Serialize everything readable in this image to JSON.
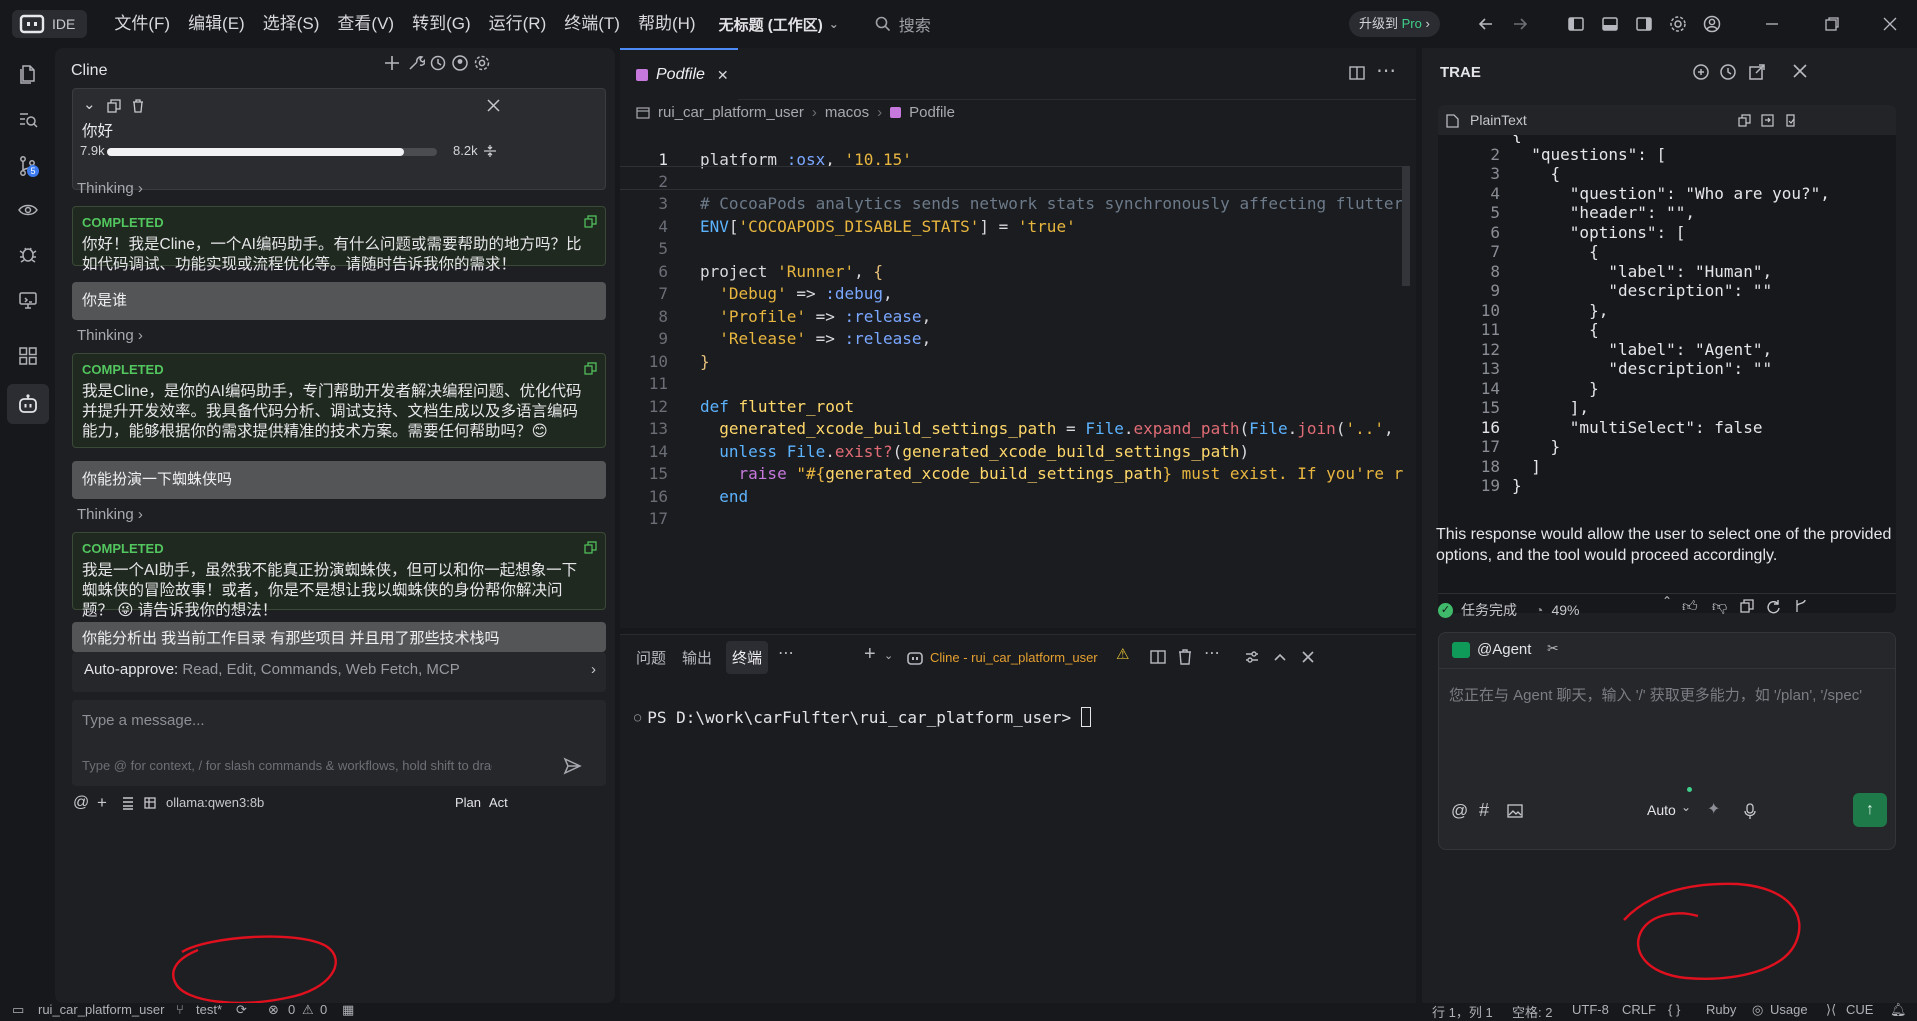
{
  "titlebar": {
    "ide_label": "IDE",
    "menus": [
      "文件(F)",
      "编辑(E)",
      "选择(S)",
      "查看(V)",
      "转到(G)",
      "运行(R)",
      "终端(T)",
      "帮助(H)"
    ],
    "workspace": "无标题 (工作区)",
    "search": "搜索",
    "upgrade_prefix": "升级到",
    "upgrade_pro": "Pro"
  },
  "cline": {
    "title": "Cline",
    "task": {
      "text": "你好",
      "tokens_in": "7.9k",
      "tokens_out": "8.2k",
      "progress": 0.9
    },
    "thinking": "Thinking",
    "messages": [
      {
        "type": "completed",
        "label": "COMPLETED",
        "text": "你好！我是Cline，一个AI编码助手。有什么问题或需要帮助的地方吗？比如代码调试、功能实现或流程优化等。请随时告诉我你的需求！"
      },
      {
        "type": "user",
        "text": "你是谁"
      },
      {
        "type": "completed",
        "label": "COMPLETED",
        "text": "我是Cline，是你的AI编码助手，专门帮助开发者解决编程问题、优化代码并提升开发效率。我具备代码分析、调试支持、文档生成以及多语言编码能力，能够根据你的需求提供精准的技术方案。需要任何帮助吗？😊"
      },
      {
        "type": "user",
        "text": "你能扮演一下蜘蛛侠吗"
      },
      {
        "type": "completed",
        "label": "COMPLETED",
        "text": "我是一个AI助手，虽然我不能真正扮演蜘蛛侠，但可以和你一起想象一下蜘蛛侠的冒险故事！或者，你是不是想让我以蜘蛛侠的身份帮你解决问题？ 😜 请告诉我你的想法！"
      },
      {
        "type": "user",
        "text": "你能分析出 我当前工作目录 有那些项目 并且用了那些技术栈吗"
      }
    ],
    "auto_approve_label": "Auto-approve:",
    "auto_approve_value": "Read, Edit, Commands, Web Fetch, MCP",
    "input_placeholder": "Type a message...",
    "input_hint": "Type @ for context, / for slash commands & workflows, hold shift to drag in...",
    "model": "ollama:qwen3:8b",
    "plan": "Plan",
    "act": "Act"
  },
  "editor": {
    "tab": "Podfile",
    "breadcrumb": [
      "rui_car_platform_user",
      "macos",
      "Podfile"
    ],
    "current_line": 1
  },
  "terminal": {
    "tabs": [
      "问题",
      "输出",
      "终端"
    ],
    "session": "Cline - rui_car_platform_user",
    "prompt": "PS D:\\work\\carFulfter\\rui_car_platform_user> "
  },
  "trae": {
    "title": "TRAE",
    "code_lang": "PlainText",
    "current_line": 16,
    "response": "This response would allow the user to select one of the provided options, and the tool would proceed accordingly.",
    "task_done": "任务完成",
    "percent": "49%",
    "agent": "@Agent",
    "input_placeholder": "您正在与 Agent 聊天，输入 '/' 获取更多能力，如 '/plan', '/spec'",
    "mode": "Auto"
  },
  "status": {
    "branch_folder": "rui_car_platform_user",
    "git": "test*",
    "errors": "0",
    "warnings": "0",
    "position": "行 1，列 1",
    "spaces": "空格: 2",
    "encoding": "UTF-8",
    "eol": "CRLF",
    "braces": "{ }",
    "language": "Ruby",
    "usage": "Usage",
    "cue": "CUE"
  },
  "colors": {
    "accent": "#4c8bf5",
    "completed": "#52c65f",
    "annotation": "#e0101e",
    "send": "#1f7a4a"
  }
}
